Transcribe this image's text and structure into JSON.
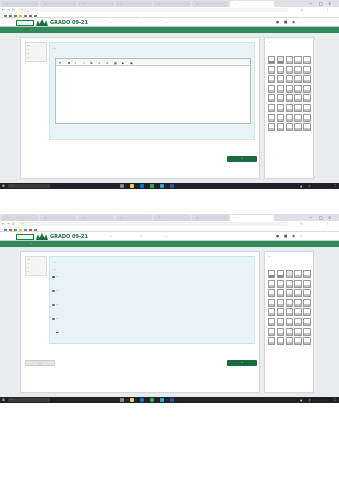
{
  "browser": {
    "tabs": [
      {
        "title": "...",
        "active": false
      },
      {
        "title": "...",
        "active": false
      },
      {
        "title": "...",
        "active": false
      },
      {
        "title": "...",
        "active": false
      },
      {
        "title": "...",
        "active": false
      },
      {
        "title": "...",
        "active": false
      },
      {
        "title": "...",
        "active": true
      }
    ],
    "address": "..."
  },
  "header": {
    "course_title": "GRADO 09-21",
    "menu": [
      "...",
      "...",
      "..."
    ],
    "username": "..."
  },
  "breadcrumb": "...",
  "screen1": {
    "question_info": {
      "label": "...",
      "status": "...",
      "points": "...",
      "flag": "..."
    },
    "question_text": "...",
    "answer_text": "...",
    "next_button": "..."
  },
  "screen2": {
    "question_info": {
      "label": "...",
      "status": "...",
      "points": "...",
      "flag": "..."
    },
    "question_text": "...",
    "answer_head": "...",
    "options": [
      "...",
      "...",
      "...",
      "..."
    ],
    "selected_option": 0,
    "clear_choice": "...",
    "prev_button": "...",
    "next_button": "..."
  },
  "navigation": {
    "title": "...",
    "numbers": [
      "",
      "",
      "",
      "",
      "",
      "",
      "",
      "",
      "",
      "",
      "",
      "",
      "",
      "",
      "",
      "",
      "",
      "",
      "",
      "",
      "",
      "",
      "",
      "",
      "",
      "",
      "",
      "",
      "",
      "",
      "",
      "",
      "",
      "",
      "",
      "",
      "",
      "",
      "",
      ""
    ]
  },
  "taskbar": {
    "search_placeholder": "...",
    "time": "...",
    "date": "..."
  },
  "colors": {
    "brand_green": "#1a6b3f",
    "crumb_green": "#2f8a59",
    "question_bg": "#e7f3f5"
  }
}
